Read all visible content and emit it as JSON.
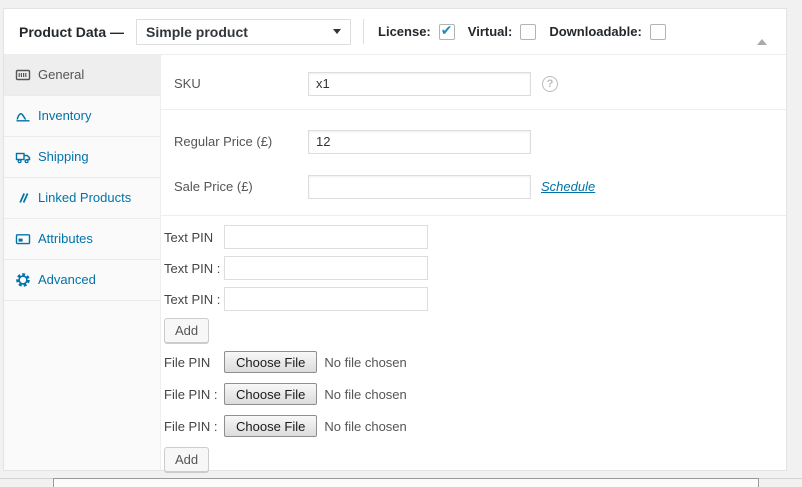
{
  "header": {
    "title": "Product Data —",
    "product_type": {
      "value": "Simple product"
    },
    "checkboxes": [
      {
        "label": "License:",
        "checked": true,
        "glyph": "✔"
      },
      {
        "label": "Virtual:",
        "checked": false,
        "glyph": ""
      },
      {
        "label": "Downloadable:",
        "checked": false,
        "glyph": ""
      }
    ]
  },
  "sidebar": {
    "tabs": [
      {
        "label": "General",
        "icon": "barcode-icon",
        "active": true
      },
      {
        "label": "Inventory",
        "icon": "chart-icon",
        "active": false
      },
      {
        "label": "Shipping",
        "icon": "truck-icon",
        "active": false
      },
      {
        "label": "Linked Products",
        "icon": "link-icon",
        "active": false
      },
      {
        "label": "Attributes",
        "icon": "tag-icon",
        "active": false
      },
      {
        "label": "Advanced",
        "icon": "gear-icon",
        "active": false
      }
    ]
  },
  "general": {
    "sku": {
      "label": "SKU",
      "value": "x1",
      "help_glyph": "?"
    },
    "regular_price": {
      "label": "Regular Price (£)",
      "value": "12"
    },
    "sale_price": {
      "label": "Sale Price (£)",
      "value": "",
      "schedule_label": "Schedule"
    },
    "text_pins": [
      {
        "label": "Text PIN",
        "value": ""
      },
      {
        "label": "Text PIN :",
        "value": ""
      },
      {
        "label": "Text PIN :",
        "value": ""
      }
    ],
    "text_pin_add_label": "Add",
    "file_pins": [
      {
        "label": "File PIN",
        "button_label": "Choose File",
        "status": "No file chosen"
      },
      {
        "label": "File PIN :",
        "button_label": "Choose File",
        "status": "No file chosen"
      },
      {
        "label": "File PIN :",
        "button_label": "Choose File",
        "status": "No file chosen"
      }
    ],
    "file_pin_add_label": "Add"
  },
  "colors": {
    "tab_link_blue": "#0073aa",
    "check_blue": "#1e8cbe",
    "active_tab_bg": "#eeeeee",
    "panel_bg": "#ffffff",
    "page_bg": "#f1f1f1"
  }
}
